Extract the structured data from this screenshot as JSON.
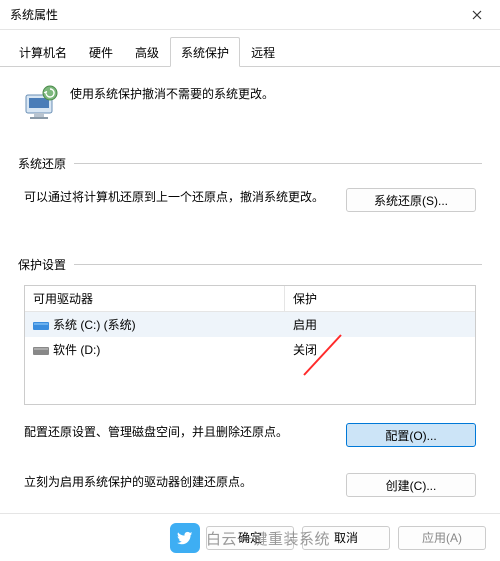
{
  "window": {
    "title": "系统属性"
  },
  "tabs": {
    "computer_name": "计算机名",
    "hardware": "硬件",
    "advanced": "高级",
    "system_protection": "系统保护",
    "remote": "远程"
  },
  "intro": {
    "text": "使用系统保护撤消不需要的系统更改。"
  },
  "restore_section": {
    "title": "系统还原",
    "description": "可以通过将计算机还原到上一个还原点，撤消系统更改。",
    "button": "系统还原(S)..."
  },
  "protection_section": {
    "title": "保护设置",
    "columns": {
      "drive": "可用驱动器",
      "protection": "保护"
    },
    "drives": [
      {
        "name": "系统 (C:) (系统)",
        "status": "启用",
        "icon": "disk-blue"
      },
      {
        "name": "软件 (D:)",
        "status": "关闭",
        "icon": "disk-gray"
      }
    ],
    "configure_text": "配置还原设置、管理磁盘空间，并且删除还原点。",
    "configure_button": "配置(O)...",
    "create_text": "立刻为启用系统保护的驱动器创建还原点。",
    "create_button": "创建(C)..."
  },
  "footer": {
    "ok": "确定",
    "cancel": "取消",
    "apply": "应用(A)"
  },
  "watermark": {
    "text": "白云一键重装系统"
  }
}
